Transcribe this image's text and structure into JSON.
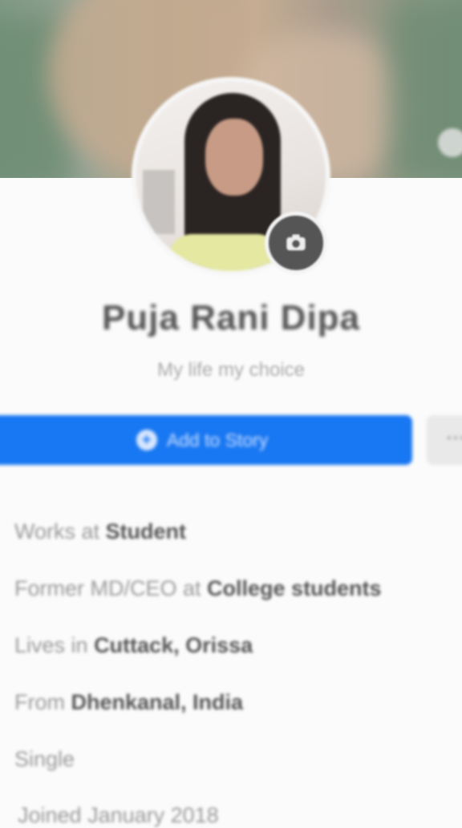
{
  "profile": {
    "name": "Puja Rani Dipa",
    "bio": "My life my choice"
  },
  "actions": {
    "add_story_label": "Add to Story",
    "add_story_icon": "plus-circle-icon",
    "more_label": "···"
  },
  "info": [
    {
      "prefix": "Works at ",
      "value": "Student"
    },
    {
      "prefix": "Former MD/CEO at ",
      "value": "College students"
    },
    {
      "prefix": "Lives in ",
      "value": "Cuttack, Orissa"
    },
    {
      "prefix": "From ",
      "value": "Dhenkanal, India"
    },
    {
      "prefix": "",
      "value": "Single"
    },
    {
      "prefix": "Joined ",
      "value": "January 2018"
    }
  ],
  "colors": {
    "accent": "#1877f2",
    "background": "#fbfbfb"
  },
  "icons": {
    "camera": "camera-icon"
  }
}
